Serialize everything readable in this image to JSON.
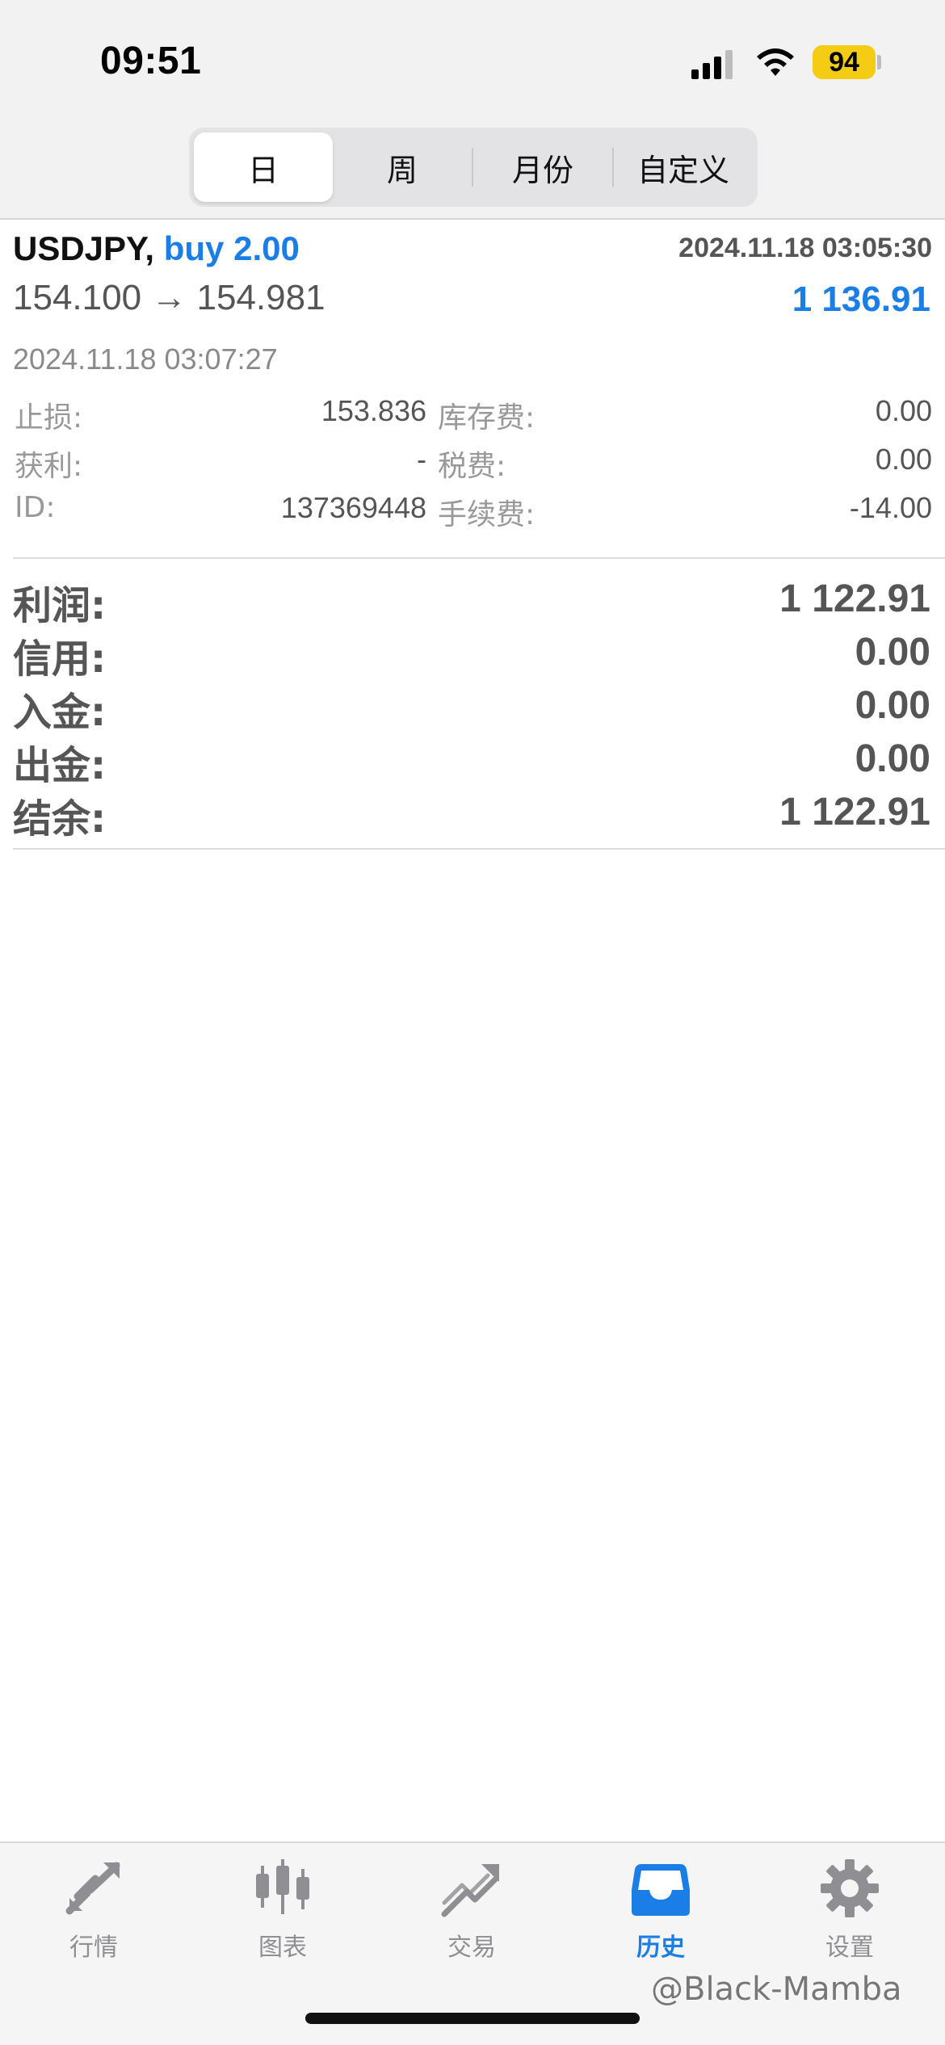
{
  "status_bar": {
    "time": "09:51",
    "battery": "94",
    "icons": [
      "cellular-signal-icon",
      "wifi-icon",
      "battery-icon"
    ]
  },
  "period_tabs": [
    {
      "label": "日",
      "active": true
    },
    {
      "label": "周",
      "active": false
    },
    {
      "label": "月份",
      "active": false
    },
    {
      "label": "自定义",
      "active": false
    }
  ],
  "trade": {
    "symbol": "USDJPY,",
    "side": "buy 2.00",
    "open_time": "2024.11.18 03:05:30",
    "prices": "154.100 → 154.981",
    "profit": "1 136.91",
    "close_time": "2024.11.18 03:07:27",
    "details": [
      {
        "label1": "止损:",
        "value1": "153.836",
        "label2": "库存费:",
        "value2": "0.00"
      },
      {
        "label1": "获利:",
        "value1": "-",
        "label2": "税费:",
        "value2": "0.00"
      },
      {
        "label1": "ID:",
        "value1": "137369448",
        "label2": "手续费:",
        "value2": "-14.00"
      }
    ]
  },
  "summary": [
    {
      "label": "利润:",
      "value": "1 122.91"
    },
    {
      "label": "信用:",
      "value": "0.00"
    },
    {
      "label": "入金:",
      "value": "0.00"
    },
    {
      "label": "出金:",
      "value": "0.00"
    },
    {
      "label": "结余:",
      "value": "1 122.91"
    }
  ],
  "tabbar": [
    {
      "label": "行情",
      "icon": "quotes-arrows-icon",
      "active": false
    },
    {
      "label": "图表",
      "icon": "candlestick-chart-icon",
      "active": false
    },
    {
      "label": "交易",
      "icon": "trade-trend-icon",
      "active": false
    },
    {
      "label": "历史",
      "icon": "history-inbox-icon",
      "active": true
    },
    {
      "label": "设置",
      "icon": "settings-gear-icon",
      "active": false
    }
  ],
  "colors": {
    "accent": "#1a7ee6",
    "battery": "#f5cc14",
    "inactive_tab": "#8e8e93"
  },
  "watermark": "@Black-Mamba"
}
